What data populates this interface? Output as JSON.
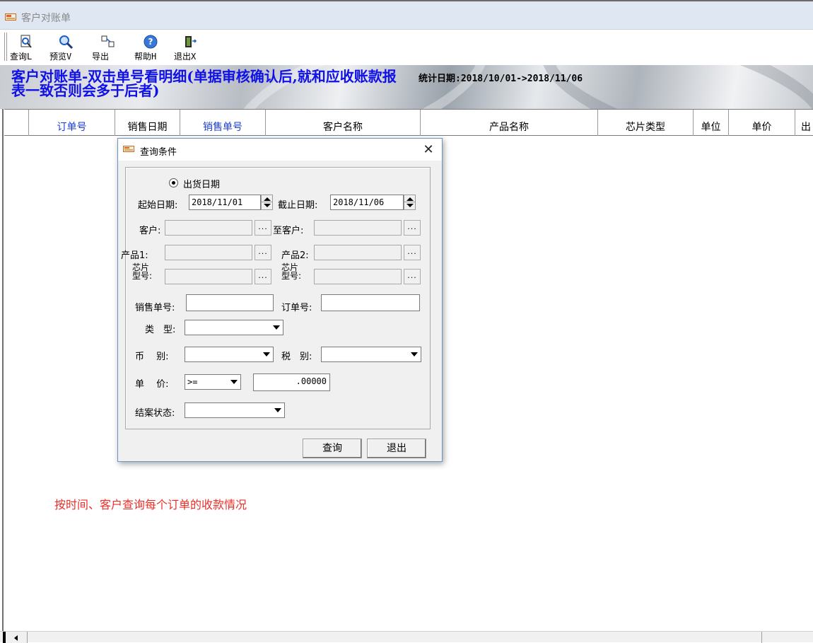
{
  "window": {
    "title": "客户对账单"
  },
  "toolbar": {
    "buttons": [
      {
        "label": "查询L",
        "icon": "query-icon"
      },
      {
        "label": "预览V",
        "icon": "preview-icon"
      },
      {
        "label": "导出",
        "icon": "export-icon"
      },
      {
        "label": "帮助H",
        "icon": "help-icon"
      },
      {
        "label": "退出X",
        "icon": "exit-icon"
      }
    ]
  },
  "banner": {
    "heading": "客户对账单-双击单号看明细(单据审核确认后,就和应收账款报表一致否则会多于后者)",
    "stat_label": "统计日期:",
    "stat_value": "2018/10/01->2018/11/06"
  },
  "grid": {
    "columns": [
      "",
      "订单号",
      "销售日期",
      "销售单号",
      "客户名称",
      "产品名称",
      "芯片类型",
      "单位",
      "单价",
      "出"
    ]
  },
  "note": "按时间、客户查询每个订单的收款情况",
  "dialog": {
    "title": "查询条件",
    "close": "✕",
    "radio_label": "出货日期",
    "start_label": "起始日期:",
    "start_value": "2018/11/01",
    "end_label": "截止日期:",
    "end_value": "2018/11/06",
    "customer_label": "客户:",
    "to_customer_label": "至客户:",
    "product1_label": "产品1:",
    "product2_label": "产品2:",
    "chip_label_top": "芯片",
    "chip_label_bottom": "型号:",
    "sales_no_label": "销售单号:",
    "sales_no_value": "",
    "order_no_label": "订单号:",
    "order_no_value": "",
    "type_label": "类　型:",
    "type_value": "",
    "currency_label": "币　 别:",
    "currency_value": "",
    "tax_label": "税　别:",
    "tax_value": "",
    "price_label": "单　 价:",
    "price_op": ">=",
    "price_value": ".00000",
    "status_label": "结案状态:",
    "status_value": "",
    "ellipsis": "...",
    "query_button": "查询",
    "exit_button": "退出"
  }
}
